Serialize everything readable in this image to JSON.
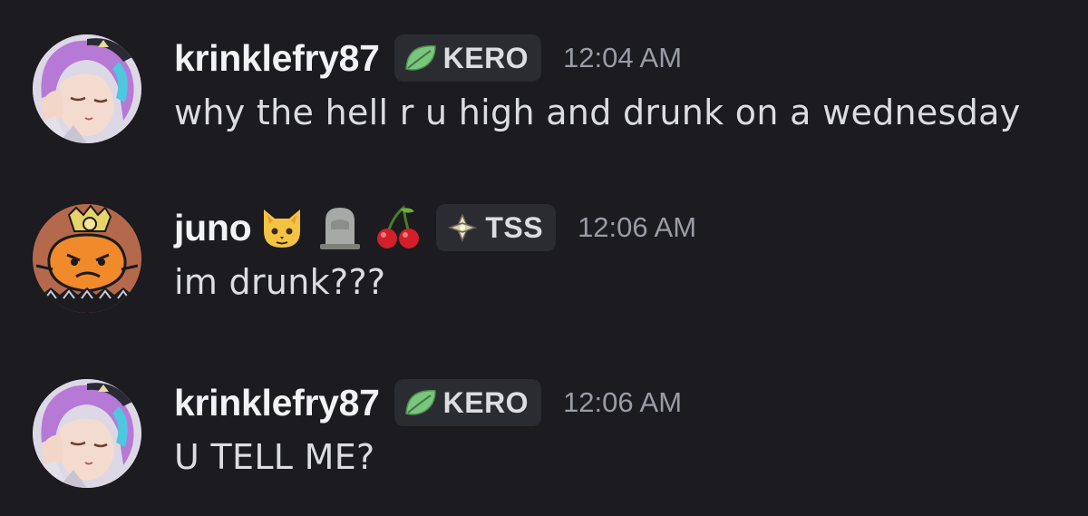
{
  "messages": [
    {
      "username": "krinklefry87",
      "tag": {
        "label": "KERO",
        "icon": "leaf-icon",
        "color": "#7bc67e"
      },
      "timestamp": "12:04 AM",
      "content": "why the hell r u high and drunk on a wednesday",
      "avatar": "anime-character-avatar"
    },
    {
      "username": "juno",
      "emojis": [
        "cat-face-emoji",
        "headstone-emoji",
        "cherries-emoji"
      ],
      "tag": {
        "label": "TSS",
        "icon": "sparkle-diamond-icon",
        "color": "#e8e2c8"
      },
      "timestamp": "12:06 AM",
      "content": "im drunk???",
      "avatar": "orange-creature-avatar"
    },
    {
      "username": "krinklefry87",
      "tag": {
        "label": "KERO",
        "icon": "leaf-icon",
        "color": "#7bc67e"
      },
      "timestamp": "12:06 AM",
      "content": "U TELL ME?",
      "avatar": "anime-character-avatar"
    }
  ],
  "theme": {
    "background": "#1b1b20",
    "tag_background": "#2b2c31",
    "username_color": "#f2f3f5",
    "timestamp_color": "#9a9ca5",
    "text_color": "#dcdde1"
  }
}
